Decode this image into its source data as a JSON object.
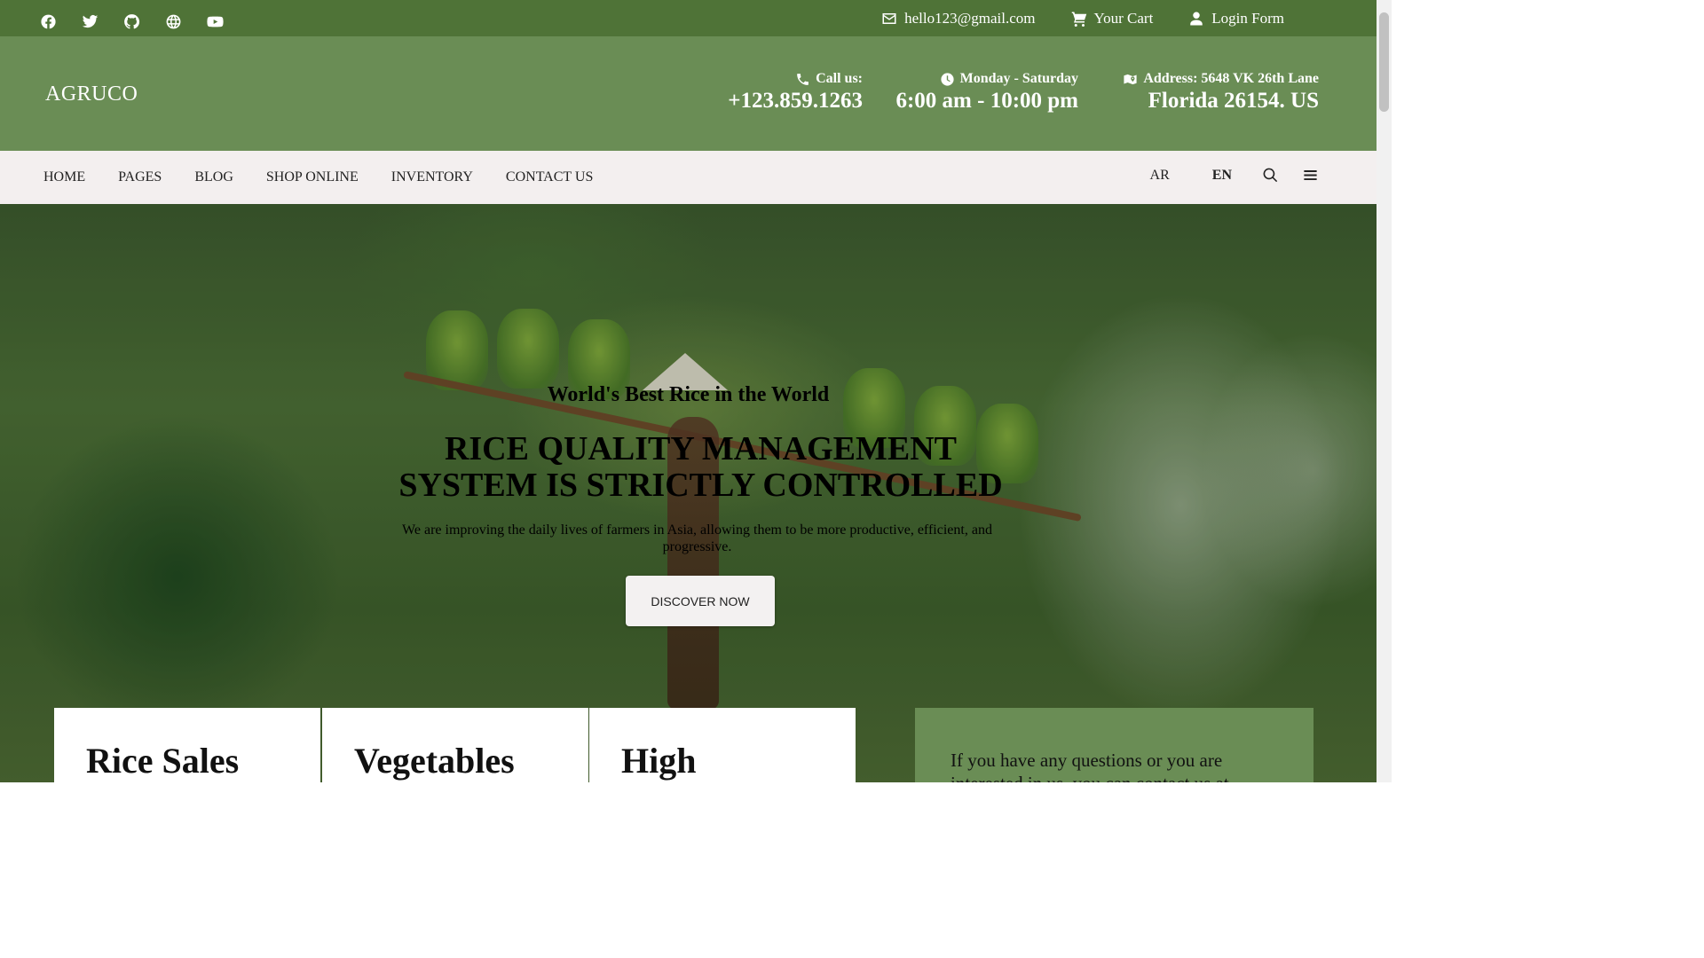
{
  "topbar": {
    "social_icons": [
      "facebook-icon",
      "twitter-icon",
      "github-icon",
      "globe-icon",
      "youtube-icon"
    ],
    "email": "hello123@gmail.com",
    "cart": "Your Cart",
    "login": "Login Form"
  },
  "header": {
    "logo": "AGRUCO",
    "call_label": "Call us:",
    "call_value": "+123.859.1263",
    "hours_label": "Monday - Saturday",
    "hours_value": "6:00 am - 10:00 pm",
    "address_label": "Address: 5648 VK 26th Lane",
    "address_value": "Florida 26154. US"
  },
  "nav": {
    "items": [
      "HOME",
      "PAGES",
      "BLOG",
      "SHOP ONLINE",
      "INVENTORY",
      "CONTACT US"
    ],
    "lang_ar": "AR",
    "lang_en": "EN"
  },
  "hero": {
    "subtitle": "World's Best Rice in the World",
    "title_line1": "RICE QUALITY MANAGEMENT",
    "title_line2": "SYSTEM IS STRICTLY CONTROLLED",
    "description": "We are improving the daily lives of farmers in Asia, allowing them to be more productive, efficient, and progressive.",
    "button": "DISCOVER NOW"
  },
  "cards": [
    "Rice Sales",
    "Vegetables",
    "High"
  ],
  "contact_box": {
    "text": "If you have any questions or you are interested in us, you can contact us at"
  },
  "colors": {
    "topbar": "#4f7337",
    "header": "#6a8d55",
    "nav": "#f3efef"
  }
}
